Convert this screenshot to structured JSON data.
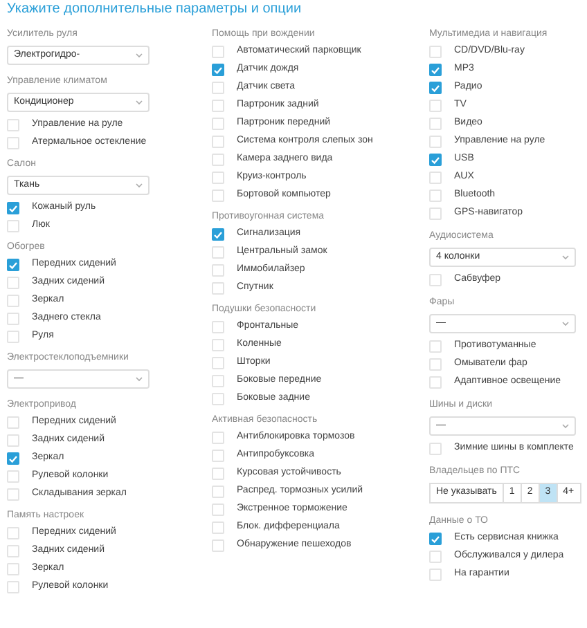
{
  "title": "Укажите дополнительные параметры и опции",
  "columns": [
    [
      {
        "label": "Усилитель руля",
        "controls": [
          {
            "kind": "select",
            "value": "Электрогидро-"
          }
        ]
      },
      {
        "label": "Управление климатом",
        "controls": [
          {
            "kind": "select",
            "value": "Кондиционер"
          },
          {
            "kind": "checkbox",
            "label": "Управление на руле",
            "checked": false
          },
          {
            "kind": "checkbox",
            "label": "Атермальное остекление",
            "checked": false
          }
        ]
      },
      {
        "label": "Салон",
        "controls": [
          {
            "kind": "select",
            "value": "Ткань"
          },
          {
            "kind": "checkbox",
            "label": "Кожаный руль",
            "checked": true
          },
          {
            "kind": "checkbox",
            "label": "Люк",
            "checked": false
          }
        ]
      },
      {
        "label": "Обогрев",
        "controls": [
          {
            "kind": "checkbox",
            "label": "Передних сидений",
            "checked": true
          },
          {
            "kind": "checkbox",
            "label": "Задних сидений",
            "checked": false
          },
          {
            "kind": "checkbox",
            "label": "Зеркал",
            "checked": false
          },
          {
            "kind": "checkbox",
            "label": "Заднего стекла",
            "checked": false
          },
          {
            "kind": "checkbox",
            "label": "Руля",
            "checked": false
          }
        ]
      },
      {
        "label": "Электростеклоподъемники",
        "controls": [
          {
            "kind": "select",
            "value": "—"
          }
        ]
      },
      {
        "label": "Электропривод",
        "controls": [
          {
            "kind": "checkbox",
            "label": "Передних сидений",
            "checked": false
          },
          {
            "kind": "checkbox",
            "label": "Задних сидений",
            "checked": false
          },
          {
            "kind": "checkbox",
            "label": "Зеркал",
            "checked": true
          },
          {
            "kind": "checkbox",
            "label": "Рулевой колонки",
            "checked": false
          },
          {
            "kind": "checkbox",
            "label": "Складывания зеркал",
            "checked": false
          }
        ]
      },
      {
        "label": "Память настроек",
        "controls": [
          {
            "kind": "checkbox",
            "label": "Передних сидений",
            "checked": false
          },
          {
            "kind": "checkbox",
            "label": "Задних сидений",
            "checked": false
          },
          {
            "kind": "checkbox",
            "label": "Зеркал",
            "checked": false
          },
          {
            "kind": "checkbox",
            "label": "Рулевой колонки",
            "checked": false
          }
        ]
      }
    ],
    [
      {
        "label": "Помощь при вождении",
        "controls": [
          {
            "kind": "checkbox",
            "label": "Автоматический парковщик",
            "checked": false
          },
          {
            "kind": "checkbox",
            "label": "Датчик дождя",
            "checked": true
          },
          {
            "kind": "checkbox",
            "label": "Датчик света",
            "checked": false
          },
          {
            "kind": "checkbox",
            "label": "Партроник задний",
            "checked": false
          },
          {
            "kind": "checkbox",
            "label": "Партроник передний",
            "checked": false
          },
          {
            "kind": "checkbox",
            "label": "Система контроля слепых зон",
            "checked": false
          },
          {
            "kind": "checkbox",
            "label": "Камера заднего вида",
            "checked": false
          },
          {
            "kind": "checkbox",
            "label": "Круиз-контроль",
            "checked": false
          },
          {
            "kind": "checkbox",
            "label": "Бортовой компьютер",
            "checked": false
          }
        ]
      },
      {
        "label": "Противоугонная система",
        "controls": [
          {
            "kind": "checkbox",
            "label": "Сигнализация",
            "checked": true
          },
          {
            "kind": "checkbox",
            "label": "Центральный замок",
            "checked": false
          },
          {
            "kind": "checkbox",
            "label": "Иммобилайзер",
            "checked": false
          },
          {
            "kind": "checkbox",
            "label": "Спутник",
            "checked": false
          }
        ]
      },
      {
        "label": "Подушки безопасности",
        "controls": [
          {
            "kind": "checkbox",
            "label": "Фронтальные",
            "checked": false
          },
          {
            "kind": "checkbox",
            "label": "Коленные",
            "checked": false
          },
          {
            "kind": "checkbox",
            "label": "Шторки",
            "checked": false
          },
          {
            "kind": "checkbox",
            "label": "Боковые передние",
            "checked": false
          },
          {
            "kind": "checkbox",
            "label": "Боковые задние",
            "checked": false
          }
        ]
      },
      {
        "label": "Активная безопасность",
        "controls": [
          {
            "kind": "checkbox",
            "label": "Антиблокировка тормозов",
            "checked": false
          },
          {
            "kind": "checkbox",
            "label": "Антипробуксовка",
            "checked": false
          },
          {
            "kind": "checkbox",
            "label": "Курсовая устойчивость",
            "checked": false
          },
          {
            "kind": "checkbox",
            "label": "Распред. тормозных усилий",
            "checked": false
          },
          {
            "kind": "checkbox",
            "label": "Экстренное торможение",
            "checked": false
          },
          {
            "kind": "checkbox",
            "label": "Блок. дифференциала",
            "checked": false
          },
          {
            "kind": "checkbox",
            "label": "Обнаружение пешеходов",
            "checked": false
          }
        ]
      }
    ],
    [
      {
        "label": "Мультимедиа и навигация",
        "controls": [
          {
            "kind": "checkbox",
            "label": "CD/DVD/Blu-ray",
            "checked": false
          },
          {
            "kind": "checkbox",
            "label": "MP3",
            "checked": true
          },
          {
            "kind": "checkbox",
            "label": "Радио",
            "checked": true
          },
          {
            "kind": "checkbox",
            "label": "TV",
            "checked": false
          },
          {
            "kind": "checkbox",
            "label": "Видео",
            "checked": false
          },
          {
            "kind": "checkbox",
            "label": "Управление на руле",
            "checked": false
          },
          {
            "kind": "checkbox",
            "label": "USB",
            "checked": true
          },
          {
            "kind": "checkbox",
            "label": "AUX",
            "checked": false
          },
          {
            "kind": "checkbox",
            "label": "Bluetooth",
            "checked": false
          },
          {
            "kind": "checkbox",
            "label": "GPS-навигатор",
            "checked": false
          }
        ]
      },
      {
        "label": "Аудиосистема",
        "controls": [
          {
            "kind": "select",
            "value": "4 колонки"
          },
          {
            "kind": "checkbox",
            "label": "Сабвуфер",
            "checked": false
          }
        ]
      },
      {
        "label": "Фары",
        "controls": [
          {
            "kind": "select",
            "value": "—"
          },
          {
            "kind": "checkbox",
            "label": "Противотуманные",
            "checked": false
          },
          {
            "kind": "checkbox",
            "label": "Омыватели фар",
            "checked": false
          },
          {
            "kind": "checkbox",
            "label": "Адаптивное освещение",
            "checked": false
          }
        ]
      },
      {
        "label": "Шины и диски",
        "controls": [
          {
            "kind": "select",
            "value": "—"
          },
          {
            "kind": "checkbox",
            "label": "Зимние шины в комплекте",
            "checked": false
          }
        ]
      },
      {
        "label": "Владельцев по ПТС",
        "controls": [
          {
            "kind": "segmented",
            "options": [
              {
                "label": "Не указывать",
                "selected": false
              },
              {
                "label": "1",
                "selected": false
              },
              {
                "label": "2",
                "selected": false
              },
              {
                "label": "3",
                "selected": true
              },
              {
                "label": "4+",
                "selected": false
              }
            ]
          }
        ]
      },
      {
        "label": "Данные о ТО",
        "controls": [
          {
            "kind": "checkbox",
            "label": "Есть сервисная книжка",
            "checked": true
          },
          {
            "kind": "checkbox",
            "label": "Обслуживался у дилера",
            "checked": false
          },
          {
            "kind": "checkbox",
            "label": "На гарантии",
            "checked": false
          }
        ]
      }
    ]
  ]
}
